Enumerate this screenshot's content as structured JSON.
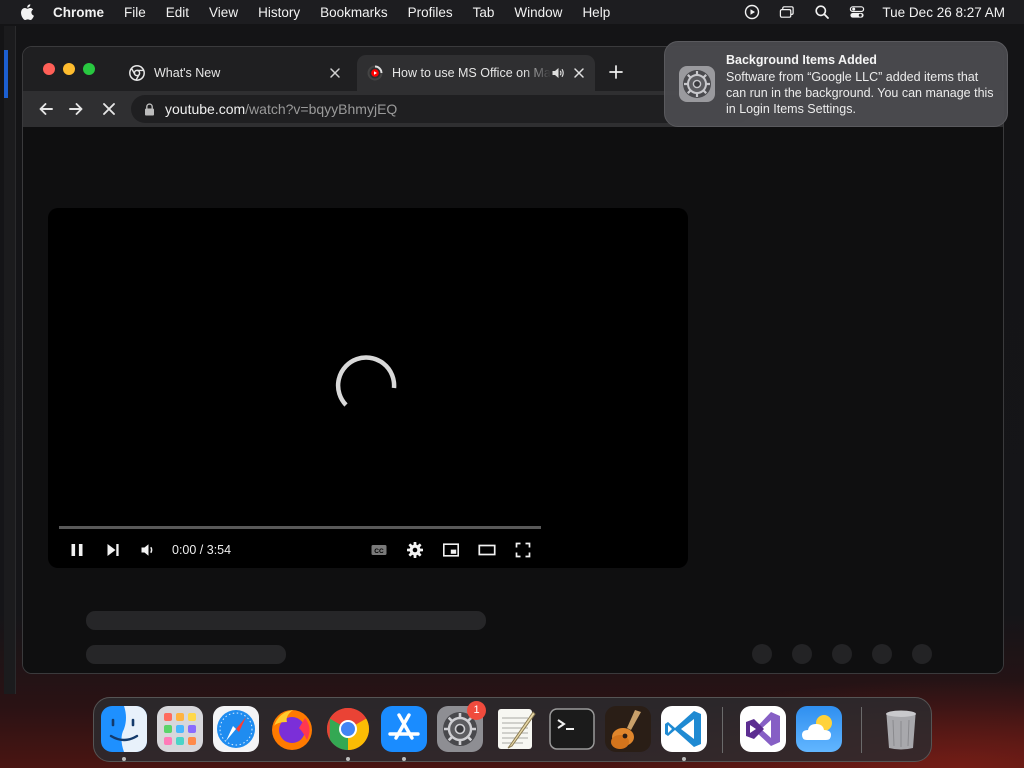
{
  "menubar": {
    "app_name": "Chrome",
    "menus": [
      "File",
      "Edit",
      "View",
      "History",
      "Bookmarks",
      "Profiles",
      "Tab",
      "Window",
      "Help"
    ],
    "clock": "Tue Dec 26  8:27 AM"
  },
  "browser": {
    "tabs": [
      {
        "title": "What's New",
        "state": "inactive"
      },
      {
        "title": "How to use MS Office on Mac",
        "state": "active",
        "audio": true
      }
    ],
    "url": {
      "domain": "youtube.com",
      "path": "/watch?v=bqyyBhmyjEQ"
    }
  },
  "player": {
    "state": "loading",
    "time": "0:00 / 3:54",
    "progress": 0
  },
  "notification": {
    "title": "Background Items Added",
    "body": "Software from “Google LLC” added items that can run in the background. You can manage this in Login Items Settings.",
    "icon": "system-settings-gear-icon"
  },
  "dock": {
    "apps": [
      "Finder",
      "Launchpad",
      "Safari",
      "Firefox",
      "Google Chrome",
      "App Store",
      "System Settings",
      "TextEdit",
      "Terminal",
      "GarageBand",
      "Visual Studio Code",
      "Visual Studio",
      "Weather",
      "Trash"
    ],
    "running": [
      "Finder",
      "Google Chrome",
      "App Store",
      "Visual Studio Code"
    ],
    "system_settings_badge": "1"
  },
  "colors": {
    "traffic_red": "#ff5f57",
    "traffic_yellow": "#febc2e",
    "traffic_green": "#28c840",
    "badge_red": "#f04b3d",
    "youtube_red": "#ff0000"
  }
}
